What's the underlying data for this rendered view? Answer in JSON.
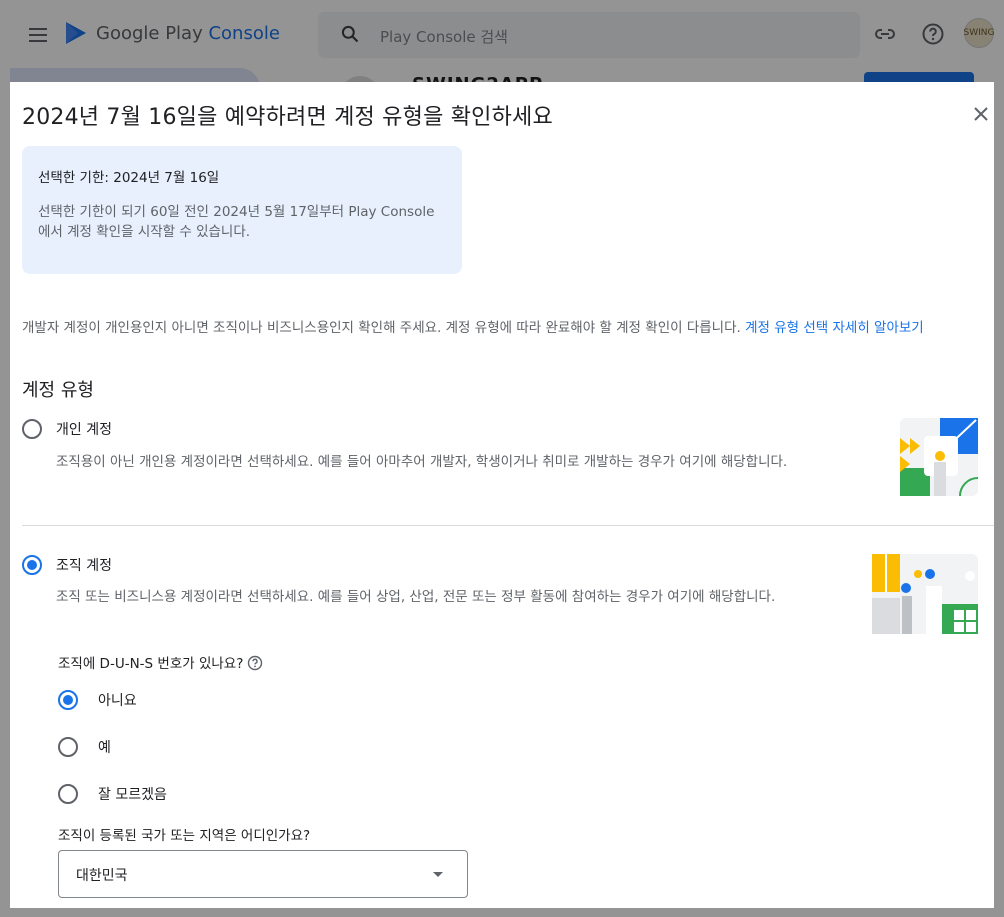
{
  "appbar": {
    "logo_prefix": "Google Play",
    "logo_suffix": "Console",
    "search_placeholder": "Play Console 검색",
    "avatar_text": "SWING",
    "app_name_fragment": "SWING2APP"
  },
  "dialog": {
    "title": "2024년 7월 16일을 예약하려면 계정 유형을 확인하세요",
    "info": {
      "deadline": "선택한 기한: 2024년 7월 16일",
      "description": "선택한 기한이 되기 60일 전인 2024년 5월 17일부터 Play Console에서 계정 확인을 시작할 수 있습니다."
    },
    "intro_text": "개발자 계정이 개인용인지 아니면 조직이나 비즈니스용인지 확인해 주세요. 계정 유형에 따라 완료해야 할 계정 확인이 다릅니다.",
    "intro_link": "계정 유형 선택 자세히 알아보기",
    "section_heading": "계정 유형",
    "options": [
      {
        "label": "개인 계정",
        "description": "조직용이 아닌 개인용 계정이라면 선택하세요. 예를 들어 아마추어 개발자, 학생이거나 취미로 개발하는 경우가 여기에 해당합니다.",
        "selected": false
      },
      {
        "label": "조직 계정",
        "description": "조직 또는 비즈니스용 계정이라면 선택하세요. 예를 들어 상업, 산업, 전문 또는 정부 활동에 참여하는 경우가 여기에 해당합니다.",
        "selected": true
      }
    ],
    "duns_question": "조직에 D-U-N-S 번호가 있나요?",
    "duns_options": [
      {
        "label": "아니요",
        "selected": true
      },
      {
        "label": "예",
        "selected": false
      },
      {
        "label": "잘 모르겠음",
        "selected": false
      }
    ],
    "country_question": "조직이 등록된 국가 또는 지역은 어디인가요?",
    "country_value": "대한민국"
  }
}
